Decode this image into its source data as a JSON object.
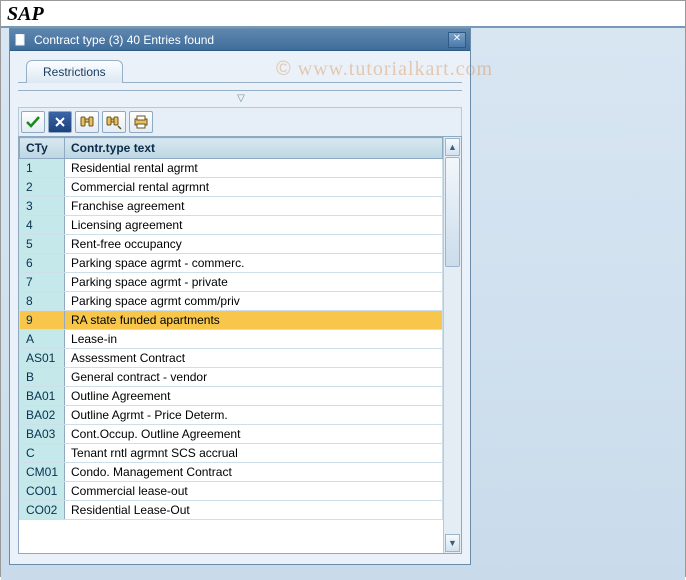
{
  "app_title": "SAP",
  "watermark": "www.tutorialkart.com",
  "dialog": {
    "title": "Contract type (3)   40 Entries found",
    "tab_label": "Restrictions",
    "columns": {
      "c1": "CTy",
      "c2": "Contr.type text"
    },
    "rows": [
      {
        "code": "1",
        "text": "Residential rental agrmt",
        "selected": false
      },
      {
        "code": "2",
        "text": "Commercial rental agrmnt",
        "selected": false
      },
      {
        "code": "3",
        "text": "Franchise agreement",
        "selected": false
      },
      {
        "code": "4",
        "text": "Licensing agreement",
        "selected": false
      },
      {
        "code": "5",
        "text": "Rent-free occupancy",
        "selected": false
      },
      {
        "code": "6",
        "text": "Parking space agrmt - commerc.",
        "selected": false
      },
      {
        "code": "7",
        "text": "Parking space agrmt - private",
        "selected": false
      },
      {
        "code": "8",
        "text": "Parking space agrmt comm/priv",
        "selected": false
      },
      {
        "code": "9",
        "text": "RA state funded apartments",
        "selected": true
      },
      {
        "code": "A",
        "text": "Lease-in",
        "selected": false
      },
      {
        "code": "AS01",
        "text": "Assessment Contract",
        "selected": false
      },
      {
        "code": "B",
        "text": "General contract - vendor",
        "selected": false
      },
      {
        "code": "BA01",
        "text": "Outline Agreement",
        "selected": false
      },
      {
        "code": "BA02",
        "text": "Outline Agrmt - Price Determ.",
        "selected": false
      },
      {
        "code": "BA03",
        "text": "Cont.Occup. Outline Agreement",
        "selected": false
      },
      {
        "code": "C",
        "text": "Tenant rntl agrmnt SCS accrual",
        "selected": false
      },
      {
        "code": "CM01",
        "text": "Condo. Management Contract",
        "selected": false
      },
      {
        "code": "CO01",
        "text": "Commercial lease-out",
        "selected": false
      },
      {
        "code": "CO02",
        "text": "Residential Lease-Out",
        "selected": false
      }
    ]
  },
  "toolbar_icons": {
    "confirm": "confirm-icon",
    "cancel": "cancel-icon",
    "find": "find-icon",
    "find_next": "find-next-icon",
    "print": "print-icon"
  }
}
